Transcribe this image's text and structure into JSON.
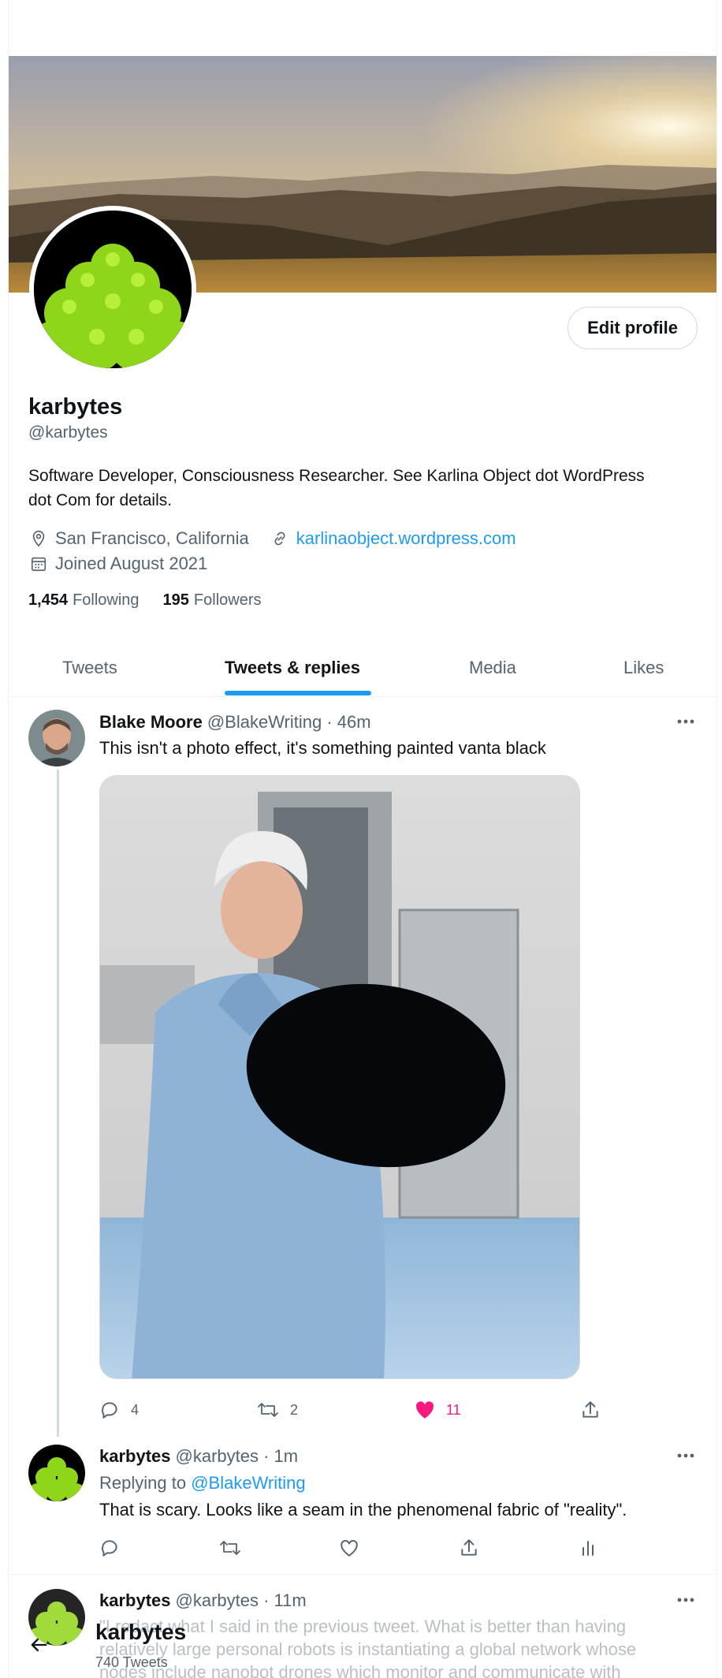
{
  "profile": {
    "name": "karbytes",
    "handle": "@karbytes",
    "bio": "Software Developer, Consciousness Researcher. See Karlina Object dot WordPress dot Com for details.",
    "location": "San Francisco, California",
    "website": "karlinaobject.wordpress.com",
    "joined": "Joined August 2021",
    "following_count": "1,454",
    "following_label": "Following",
    "followers_count": "195",
    "followers_label": "Followers",
    "edit_label": "Edit profile"
  },
  "tabs": [
    {
      "label": "Tweets",
      "active": false
    },
    {
      "label": "Tweets & replies",
      "active": true
    },
    {
      "label": "Media",
      "active": false
    },
    {
      "label": "Likes",
      "active": false
    }
  ],
  "tweets": [
    {
      "name": "Blake Moore",
      "handle_time": "@BlakeWriting · 46m",
      "text": "This isn't a photo effect, it's something painted vanta black",
      "replies": "4",
      "retweets": "2",
      "likes": "11"
    },
    {
      "name": "karbytes",
      "handle_time": "@karbytes · 1m",
      "replying_prefix": "Replying to",
      "replying_to": "@BlakeWriting",
      "text": "That is scary. Looks like a seam in the phenomenal fabric of \"reality\"."
    },
    {
      "name": "karbytes",
      "handle_time": "@karbytes · 11m",
      "text_lines": [
        "\"I redact what I said in the previous tweet. What is better than having",
        "relatively large personal robots is instantiating a global network whose",
        "nodes include nanobot drones which monitor and communicate with"
      ]
    }
  ],
  "sticky": {
    "name": "karbytes",
    "count": "740 Tweets"
  },
  "colors": {
    "accent": "#1d9bf0",
    "like": "#f91880",
    "muted": "#536471"
  }
}
